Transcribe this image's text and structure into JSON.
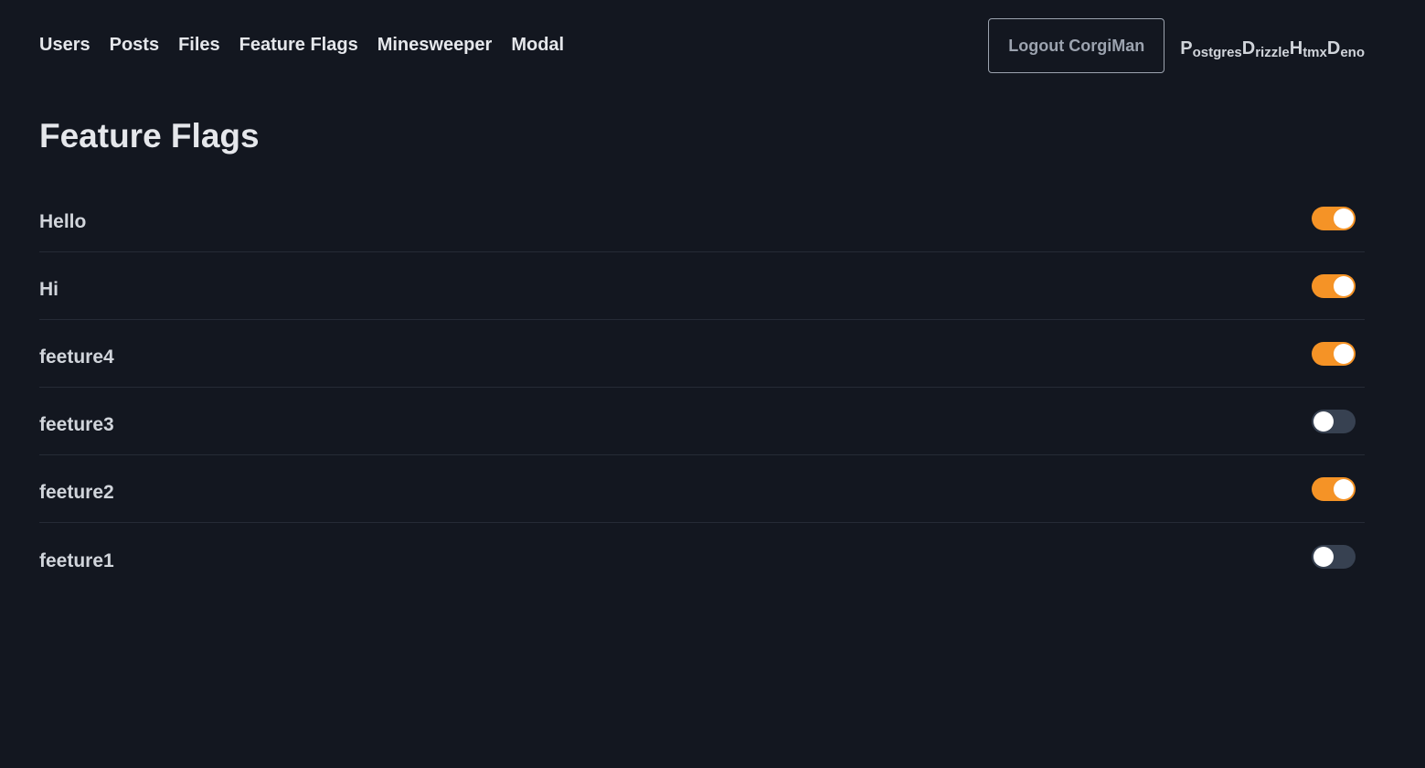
{
  "nav": {
    "links": [
      "Users",
      "Posts",
      "Files",
      "Feature Flags",
      "Minesweeper",
      "Modal"
    ]
  },
  "header": {
    "logout_label": "Logout CorgiMan",
    "brand": [
      {
        "initial": "P",
        "rest": "ostgres"
      },
      {
        "initial": "D",
        "rest": "rizzle"
      },
      {
        "initial": "H",
        "rest": "tmx"
      },
      {
        "initial": "D",
        "rest": "eno"
      }
    ]
  },
  "page": {
    "title": "Feature Flags"
  },
  "flags": [
    {
      "name": "Hello",
      "enabled": true
    },
    {
      "name": "Hi",
      "enabled": true
    },
    {
      "name": "feeture4",
      "enabled": true
    },
    {
      "name": "feeture3",
      "enabled": false
    },
    {
      "name": "feeture2",
      "enabled": true
    },
    {
      "name": "feeture1",
      "enabled": false
    }
  ],
  "colors": {
    "background": "#131720",
    "toggle_on": "#f59326",
    "toggle_off": "#374151"
  }
}
